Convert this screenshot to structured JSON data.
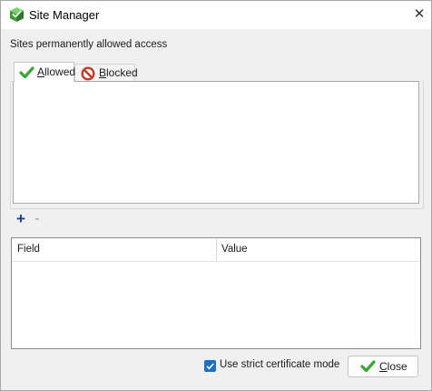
{
  "window": {
    "title": "Site Manager",
    "close_glyph": "✕"
  },
  "section_label": "Sites permanently allowed access",
  "tabs": [
    {
      "label_mnemonic": "A",
      "label_rest": "llowed",
      "icon": "green-check-icon",
      "selected": true
    },
    {
      "label_mnemonic": "B",
      "label_rest": "locked",
      "icon": "no-entry-icon",
      "selected": false
    }
  ],
  "list_actions": {
    "add_glyph": "+",
    "remove_glyph": "-"
  },
  "properties_table": {
    "columns": [
      "Field",
      "Value"
    ],
    "rows": []
  },
  "strict_mode": {
    "label": "Use strict certificate mode",
    "checked": true
  },
  "close_button": {
    "label_mnemonic": "C",
    "label_rest": "lose",
    "icon": "green-check-icon"
  },
  "colors": {
    "accent": "#1f6fc0",
    "check_green": "#3aa335",
    "blocked_red": "#c0392b"
  }
}
